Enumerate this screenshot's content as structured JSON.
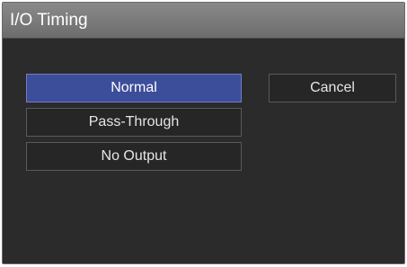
{
  "dialog": {
    "title": "I/O Timing",
    "options": [
      {
        "label": "Normal",
        "selected": true
      },
      {
        "label": "Pass-Through",
        "selected": false
      },
      {
        "label": "No Output",
        "selected": false
      }
    ],
    "cancel_label": "Cancel"
  },
  "colors": {
    "background": "#2b2b2b",
    "title_bar": "#7a7a7a",
    "selected": "#3c4d9a",
    "button": "#262626",
    "text": "#e6e6e6"
  }
}
